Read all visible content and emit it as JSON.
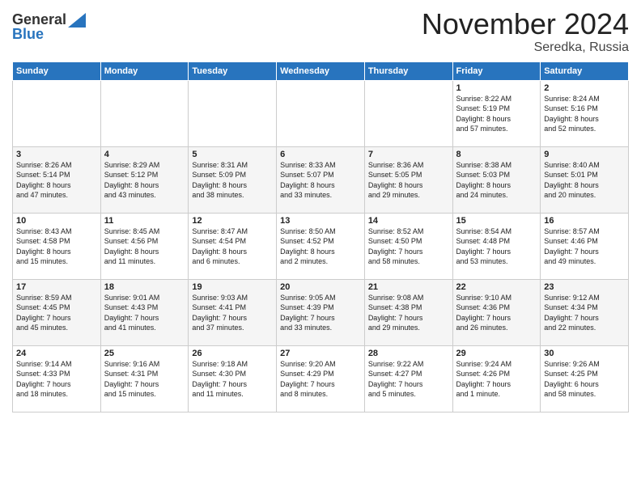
{
  "header": {
    "logo_line1": "General",
    "logo_line2": "Blue",
    "month_title": "November 2024",
    "location": "Seredka, Russia"
  },
  "days_of_week": [
    "Sunday",
    "Monday",
    "Tuesday",
    "Wednesday",
    "Thursday",
    "Friday",
    "Saturday"
  ],
  "weeks": [
    [
      {
        "day": "",
        "info": ""
      },
      {
        "day": "",
        "info": ""
      },
      {
        "day": "",
        "info": ""
      },
      {
        "day": "",
        "info": ""
      },
      {
        "day": "",
        "info": ""
      },
      {
        "day": "1",
        "info": "Sunrise: 8:22 AM\nSunset: 5:19 PM\nDaylight: 8 hours\nand 57 minutes."
      },
      {
        "day": "2",
        "info": "Sunrise: 8:24 AM\nSunset: 5:16 PM\nDaylight: 8 hours\nand 52 minutes."
      }
    ],
    [
      {
        "day": "3",
        "info": "Sunrise: 8:26 AM\nSunset: 5:14 PM\nDaylight: 8 hours\nand 47 minutes."
      },
      {
        "day": "4",
        "info": "Sunrise: 8:29 AM\nSunset: 5:12 PM\nDaylight: 8 hours\nand 43 minutes."
      },
      {
        "day": "5",
        "info": "Sunrise: 8:31 AM\nSunset: 5:09 PM\nDaylight: 8 hours\nand 38 minutes."
      },
      {
        "day": "6",
        "info": "Sunrise: 8:33 AM\nSunset: 5:07 PM\nDaylight: 8 hours\nand 33 minutes."
      },
      {
        "day": "7",
        "info": "Sunrise: 8:36 AM\nSunset: 5:05 PM\nDaylight: 8 hours\nand 29 minutes."
      },
      {
        "day": "8",
        "info": "Sunrise: 8:38 AM\nSunset: 5:03 PM\nDaylight: 8 hours\nand 24 minutes."
      },
      {
        "day": "9",
        "info": "Sunrise: 8:40 AM\nSunset: 5:01 PM\nDaylight: 8 hours\nand 20 minutes."
      }
    ],
    [
      {
        "day": "10",
        "info": "Sunrise: 8:43 AM\nSunset: 4:58 PM\nDaylight: 8 hours\nand 15 minutes."
      },
      {
        "day": "11",
        "info": "Sunrise: 8:45 AM\nSunset: 4:56 PM\nDaylight: 8 hours\nand 11 minutes."
      },
      {
        "day": "12",
        "info": "Sunrise: 8:47 AM\nSunset: 4:54 PM\nDaylight: 8 hours\nand 6 minutes."
      },
      {
        "day": "13",
        "info": "Sunrise: 8:50 AM\nSunset: 4:52 PM\nDaylight: 8 hours\nand 2 minutes."
      },
      {
        "day": "14",
        "info": "Sunrise: 8:52 AM\nSunset: 4:50 PM\nDaylight: 7 hours\nand 58 minutes."
      },
      {
        "day": "15",
        "info": "Sunrise: 8:54 AM\nSunset: 4:48 PM\nDaylight: 7 hours\nand 53 minutes."
      },
      {
        "day": "16",
        "info": "Sunrise: 8:57 AM\nSunset: 4:46 PM\nDaylight: 7 hours\nand 49 minutes."
      }
    ],
    [
      {
        "day": "17",
        "info": "Sunrise: 8:59 AM\nSunset: 4:45 PM\nDaylight: 7 hours\nand 45 minutes."
      },
      {
        "day": "18",
        "info": "Sunrise: 9:01 AM\nSunset: 4:43 PM\nDaylight: 7 hours\nand 41 minutes."
      },
      {
        "day": "19",
        "info": "Sunrise: 9:03 AM\nSunset: 4:41 PM\nDaylight: 7 hours\nand 37 minutes."
      },
      {
        "day": "20",
        "info": "Sunrise: 9:05 AM\nSunset: 4:39 PM\nDaylight: 7 hours\nand 33 minutes."
      },
      {
        "day": "21",
        "info": "Sunrise: 9:08 AM\nSunset: 4:38 PM\nDaylight: 7 hours\nand 29 minutes."
      },
      {
        "day": "22",
        "info": "Sunrise: 9:10 AM\nSunset: 4:36 PM\nDaylight: 7 hours\nand 26 minutes."
      },
      {
        "day": "23",
        "info": "Sunrise: 9:12 AM\nSunset: 4:34 PM\nDaylight: 7 hours\nand 22 minutes."
      }
    ],
    [
      {
        "day": "24",
        "info": "Sunrise: 9:14 AM\nSunset: 4:33 PM\nDaylight: 7 hours\nand 18 minutes."
      },
      {
        "day": "25",
        "info": "Sunrise: 9:16 AM\nSunset: 4:31 PM\nDaylight: 7 hours\nand 15 minutes."
      },
      {
        "day": "26",
        "info": "Sunrise: 9:18 AM\nSunset: 4:30 PM\nDaylight: 7 hours\nand 11 minutes."
      },
      {
        "day": "27",
        "info": "Sunrise: 9:20 AM\nSunset: 4:29 PM\nDaylight: 7 hours\nand 8 minutes."
      },
      {
        "day": "28",
        "info": "Sunrise: 9:22 AM\nSunset: 4:27 PM\nDaylight: 7 hours\nand 5 minutes."
      },
      {
        "day": "29",
        "info": "Sunrise: 9:24 AM\nSunset: 4:26 PM\nDaylight: 7 hours\nand 1 minute."
      },
      {
        "day": "30",
        "info": "Sunrise: 9:26 AM\nSunset: 4:25 PM\nDaylight: 6 hours\nand 58 minutes."
      }
    ]
  ]
}
